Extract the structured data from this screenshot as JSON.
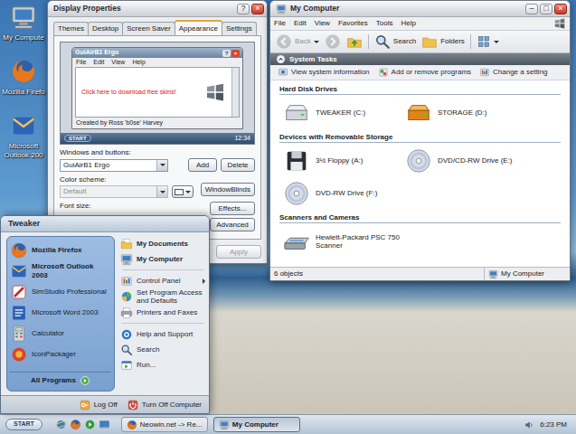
{
  "desktop": {
    "icons": [
      {
        "label": "My Compute",
        "kind": "computer"
      },
      {
        "label": "Mozilla Firefo",
        "kind": "firefox"
      },
      {
        "label": "Microsoft Outlook 200",
        "kind": "outlook"
      }
    ]
  },
  "display_properties": {
    "title": "Display Properties",
    "controls": [
      "?",
      "×"
    ],
    "tabs": [
      {
        "label": "Themes",
        "selected": false
      },
      {
        "label": "Desktop",
        "selected": false
      },
      {
        "label": "Screen Saver",
        "selected": false
      },
      {
        "label": "Appearance",
        "selected": true
      },
      {
        "label": "Settings",
        "selected": false
      }
    ],
    "preview": {
      "title": "GuiAirB1 Ergo",
      "controls": [
        "?",
        "×"
      ],
      "menu": [
        "File",
        "Edit",
        "View",
        "Help"
      ],
      "link": "Click here to download free skins!",
      "credit": "Created by Ross 'b0se' Harvey",
      "start": "START",
      "clock": "12:34"
    },
    "windows_and_buttons": {
      "label": "Windows and buttons:",
      "value": "GuiAirB1 Ergo"
    },
    "color_scheme": {
      "label": "Color scheme:",
      "value": "Default",
      "disabled": true
    },
    "font_size": {
      "label": "Font size:"
    },
    "buttons": {
      "add": "Add",
      "delete": "Delete",
      "windowblinds": "WindowBlinds",
      "effects": "Effects...",
      "advanced": "Advanced",
      "apply": {
        "label": "Apply",
        "disabled": true
      }
    }
  },
  "my_computer": {
    "title": "My Computer",
    "controls": [
      "–",
      "□",
      "×"
    ],
    "menu": [
      "File",
      "Edit",
      "View",
      "Favorites",
      "Tools",
      "Help"
    ],
    "toolbar": {
      "back": {
        "label": "Back",
        "disabled": true
      },
      "forward": {
        "disabled": true
      },
      "search": "Search",
      "folders": "Folders"
    },
    "tasks": {
      "title": "System Tasks",
      "expanded": true,
      "items": [
        {
          "label": "View system information",
          "kind": "info"
        },
        {
          "label": "Add or remove programs",
          "kind": "add-remove"
        },
        {
          "label": "Change a setting",
          "kind": "setting"
        }
      ]
    },
    "sections": [
      {
        "title": "Hard Disk Drives",
        "items": [
          {
            "name": "TWEAKER (C:)",
            "kind": "hdd"
          },
          {
            "name": "STORAGE (D:)",
            "kind": "storage"
          }
        ]
      },
      {
        "title": "Devices with Removable Storage",
        "items": [
          {
            "name": "3½ Floppy (A:)",
            "kind": "floppy"
          },
          {
            "name": "DVD/CD-RW Drive (E:)",
            "kind": "dvd"
          },
          {
            "name": "DVD-RW Drive (F:)",
            "kind": "dvd"
          }
        ]
      },
      {
        "title": "Scanners and Cameras",
        "items": [
          {
            "name": "Hewlett-Packard PSC 750 Scanner",
            "kind": "scanner"
          }
        ]
      }
    ],
    "status_bar": {
      "count": "6 objects",
      "location": "My Computer"
    }
  },
  "start_menu": {
    "user": "Tweaker",
    "pinned": [
      {
        "label": "Mozilla Firefox",
        "bold": true,
        "kind": "firefox"
      },
      {
        "label": "Microsoft Outlook 2003",
        "bold": true,
        "kind": "outlook"
      },
      {
        "label": "SimStudio Professional",
        "bold": false,
        "kind": "simstudio"
      },
      {
        "label": "Microsoft Word 2003",
        "bold": false,
        "kind": "word"
      },
      {
        "label": "Calculator",
        "bold": false,
        "kind": "calculator"
      },
      {
        "label": "IconPackager",
        "bold": false,
        "kind": "iconpackager"
      }
    ],
    "all_programs": "All Programs",
    "place_groups": [
      [
        {
          "label": "My Documents",
          "kind": "documents",
          "bold": true,
          "submenu": false
        },
        {
          "label": "My Computer",
          "kind": "computer",
          "bold": true,
          "submenu": false
        }
      ],
      [
        {
          "label": "Control Panel",
          "kind": "control-panel",
          "bold": false,
          "submenu": true
        },
        {
          "label": "Set Program Access and Defaults",
          "kind": "program-access",
          "bold": false,
          "submenu": false
        },
        {
          "label": "Printers and Faxes",
          "kind": "printers",
          "bold": false,
          "submenu": false
        }
      ],
      [
        {
          "label": "Help and Support",
          "kind": "help",
          "bold": false,
          "submenu": false
        },
        {
          "label": "Search",
          "kind": "search",
          "bold": false,
          "submenu": false
        },
        {
          "label": "Run...",
          "kind": "run",
          "bold": false,
          "submenu": false
        }
      ]
    ],
    "log_off": "Log Off",
    "turn_off": "Turn Off Computer"
  },
  "taskbar": {
    "start": "START",
    "tasks": [
      {
        "label": "Neowin.net -> Re...",
        "kind": "firefox",
        "selected": false
      },
      {
        "label": "My Computer",
        "kind": "computer",
        "selected": true
      }
    ],
    "clock": "6:23 PM"
  }
}
